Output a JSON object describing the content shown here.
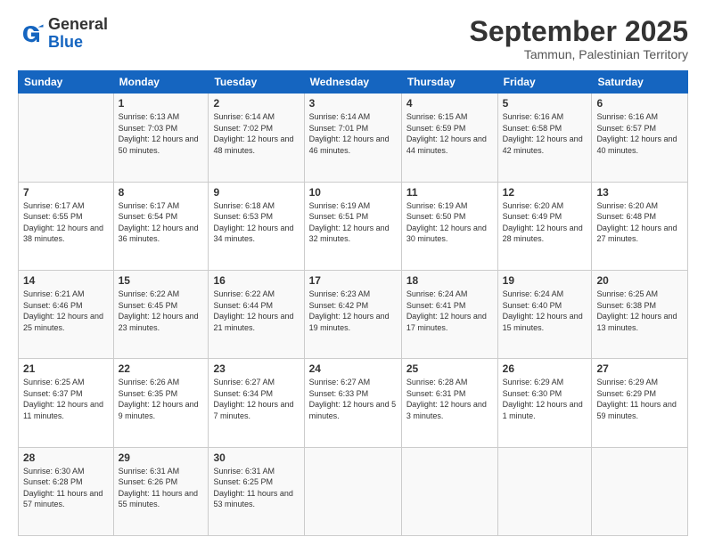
{
  "logo": {
    "line1": "General",
    "line2": "Blue"
  },
  "header": {
    "month": "September 2025",
    "location": "Tammun, Palestinian Territory"
  },
  "days_of_week": [
    "Sunday",
    "Monday",
    "Tuesday",
    "Wednesday",
    "Thursday",
    "Friday",
    "Saturday"
  ],
  "weeks": [
    [
      {
        "day": "",
        "sunrise": "",
        "sunset": "",
        "daylight": ""
      },
      {
        "day": "1",
        "sunrise": "Sunrise: 6:13 AM",
        "sunset": "Sunset: 7:03 PM",
        "daylight": "Daylight: 12 hours and 50 minutes."
      },
      {
        "day": "2",
        "sunrise": "Sunrise: 6:14 AM",
        "sunset": "Sunset: 7:02 PM",
        "daylight": "Daylight: 12 hours and 48 minutes."
      },
      {
        "day": "3",
        "sunrise": "Sunrise: 6:14 AM",
        "sunset": "Sunset: 7:01 PM",
        "daylight": "Daylight: 12 hours and 46 minutes."
      },
      {
        "day": "4",
        "sunrise": "Sunrise: 6:15 AM",
        "sunset": "Sunset: 6:59 PM",
        "daylight": "Daylight: 12 hours and 44 minutes."
      },
      {
        "day": "5",
        "sunrise": "Sunrise: 6:16 AM",
        "sunset": "Sunset: 6:58 PM",
        "daylight": "Daylight: 12 hours and 42 minutes."
      },
      {
        "day": "6",
        "sunrise": "Sunrise: 6:16 AM",
        "sunset": "Sunset: 6:57 PM",
        "daylight": "Daylight: 12 hours and 40 minutes."
      }
    ],
    [
      {
        "day": "7",
        "sunrise": "Sunrise: 6:17 AM",
        "sunset": "Sunset: 6:55 PM",
        "daylight": "Daylight: 12 hours and 38 minutes."
      },
      {
        "day": "8",
        "sunrise": "Sunrise: 6:17 AM",
        "sunset": "Sunset: 6:54 PM",
        "daylight": "Daylight: 12 hours and 36 minutes."
      },
      {
        "day": "9",
        "sunrise": "Sunrise: 6:18 AM",
        "sunset": "Sunset: 6:53 PM",
        "daylight": "Daylight: 12 hours and 34 minutes."
      },
      {
        "day": "10",
        "sunrise": "Sunrise: 6:19 AM",
        "sunset": "Sunset: 6:51 PM",
        "daylight": "Daylight: 12 hours and 32 minutes."
      },
      {
        "day": "11",
        "sunrise": "Sunrise: 6:19 AM",
        "sunset": "Sunset: 6:50 PM",
        "daylight": "Daylight: 12 hours and 30 minutes."
      },
      {
        "day": "12",
        "sunrise": "Sunrise: 6:20 AM",
        "sunset": "Sunset: 6:49 PM",
        "daylight": "Daylight: 12 hours and 28 minutes."
      },
      {
        "day": "13",
        "sunrise": "Sunrise: 6:20 AM",
        "sunset": "Sunset: 6:48 PM",
        "daylight": "Daylight: 12 hours and 27 minutes."
      }
    ],
    [
      {
        "day": "14",
        "sunrise": "Sunrise: 6:21 AM",
        "sunset": "Sunset: 6:46 PM",
        "daylight": "Daylight: 12 hours and 25 minutes."
      },
      {
        "day": "15",
        "sunrise": "Sunrise: 6:22 AM",
        "sunset": "Sunset: 6:45 PM",
        "daylight": "Daylight: 12 hours and 23 minutes."
      },
      {
        "day": "16",
        "sunrise": "Sunrise: 6:22 AM",
        "sunset": "Sunset: 6:44 PM",
        "daylight": "Daylight: 12 hours and 21 minutes."
      },
      {
        "day": "17",
        "sunrise": "Sunrise: 6:23 AM",
        "sunset": "Sunset: 6:42 PM",
        "daylight": "Daylight: 12 hours and 19 minutes."
      },
      {
        "day": "18",
        "sunrise": "Sunrise: 6:24 AM",
        "sunset": "Sunset: 6:41 PM",
        "daylight": "Daylight: 12 hours and 17 minutes."
      },
      {
        "day": "19",
        "sunrise": "Sunrise: 6:24 AM",
        "sunset": "Sunset: 6:40 PM",
        "daylight": "Daylight: 12 hours and 15 minutes."
      },
      {
        "day": "20",
        "sunrise": "Sunrise: 6:25 AM",
        "sunset": "Sunset: 6:38 PM",
        "daylight": "Daylight: 12 hours and 13 minutes."
      }
    ],
    [
      {
        "day": "21",
        "sunrise": "Sunrise: 6:25 AM",
        "sunset": "Sunset: 6:37 PM",
        "daylight": "Daylight: 12 hours and 11 minutes."
      },
      {
        "day": "22",
        "sunrise": "Sunrise: 6:26 AM",
        "sunset": "Sunset: 6:35 PM",
        "daylight": "Daylight: 12 hours and 9 minutes."
      },
      {
        "day": "23",
        "sunrise": "Sunrise: 6:27 AM",
        "sunset": "Sunset: 6:34 PM",
        "daylight": "Daylight: 12 hours and 7 minutes."
      },
      {
        "day": "24",
        "sunrise": "Sunrise: 6:27 AM",
        "sunset": "Sunset: 6:33 PM",
        "daylight": "Daylight: 12 hours and 5 minutes."
      },
      {
        "day": "25",
        "sunrise": "Sunrise: 6:28 AM",
        "sunset": "Sunset: 6:31 PM",
        "daylight": "Daylight: 12 hours and 3 minutes."
      },
      {
        "day": "26",
        "sunrise": "Sunrise: 6:29 AM",
        "sunset": "Sunset: 6:30 PM",
        "daylight": "Daylight: 12 hours and 1 minute."
      },
      {
        "day": "27",
        "sunrise": "Sunrise: 6:29 AM",
        "sunset": "Sunset: 6:29 PM",
        "daylight": "Daylight: 11 hours and 59 minutes."
      }
    ],
    [
      {
        "day": "28",
        "sunrise": "Sunrise: 6:30 AM",
        "sunset": "Sunset: 6:28 PM",
        "daylight": "Daylight: 11 hours and 57 minutes."
      },
      {
        "day": "29",
        "sunrise": "Sunrise: 6:31 AM",
        "sunset": "Sunset: 6:26 PM",
        "daylight": "Daylight: 11 hours and 55 minutes."
      },
      {
        "day": "30",
        "sunrise": "Sunrise: 6:31 AM",
        "sunset": "Sunset: 6:25 PM",
        "daylight": "Daylight: 11 hours and 53 minutes."
      },
      {
        "day": "",
        "sunrise": "",
        "sunset": "",
        "daylight": ""
      },
      {
        "day": "",
        "sunrise": "",
        "sunset": "",
        "daylight": ""
      },
      {
        "day": "",
        "sunrise": "",
        "sunset": "",
        "daylight": ""
      },
      {
        "day": "",
        "sunrise": "",
        "sunset": "",
        "daylight": ""
      }
    ]
  ]
}
